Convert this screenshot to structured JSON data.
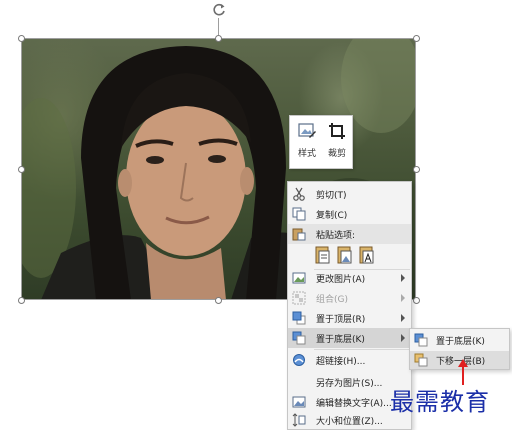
{
  "mini_toolbar": {
    "style_label": "样式",
    "crop_label": "裁剪"
  },
  "context_menu": {
    "items": [
      {
        "label": "剪切(T)",
        "icon": "scissors-icon"
      },
      {
        "label": "复制(C)",
        "icon": "copy-icon"
      },
      {
        "label": "粘贴选项:",
        "icon": "paste-icon"
      },
      {
        "label": "更改图片(A)",
        "icon": "change-picture-icon",
        "submenu": true
      },
      {
        "label": "组合(G)",
        "icon": "group-icon",
        "submenu": true,
        "disabled": true
      },
      {
        "label": "置于顶层(R)",
        "icon": "bring-to-front-icon",
        "submenu": true
      },
      {
        "label": "置于底层(K)",
        "icon": "send-to-back-icon",
        "submenu": true,
        "highlighted": true
      },
      {
        "label": "超链接(H)...",
        "icon": "hyperlink-icon"
      },
      {
        "label": "另存为图片(S)...",
        "icon": ""
      },
      {
        "label": "编辑替换文字(A)...",
        "icon": "alt-text-icon"
      },
      {
        "label": "大小和位置(Z)...",
        "icon": "size-position-icon"
      }
    ]
  },
  "submenu": {
    "items": [
      {
        "label": "置于底层(K)",
        "icon": "send-to-back-icon"
      },
      {
        "label": "下移一层(B)",
        "icon": "send-backward-icon",
        "highlighted": true
      }
    ]
  },
  "watermark": "最需教育",
  "colors": {
    "menu_bg": "#f3f3f3",
    "highlight": "#d5d5d5",
    "watermark": "#1b2fa8",
    "arrow": "#e02020"
  }
}
